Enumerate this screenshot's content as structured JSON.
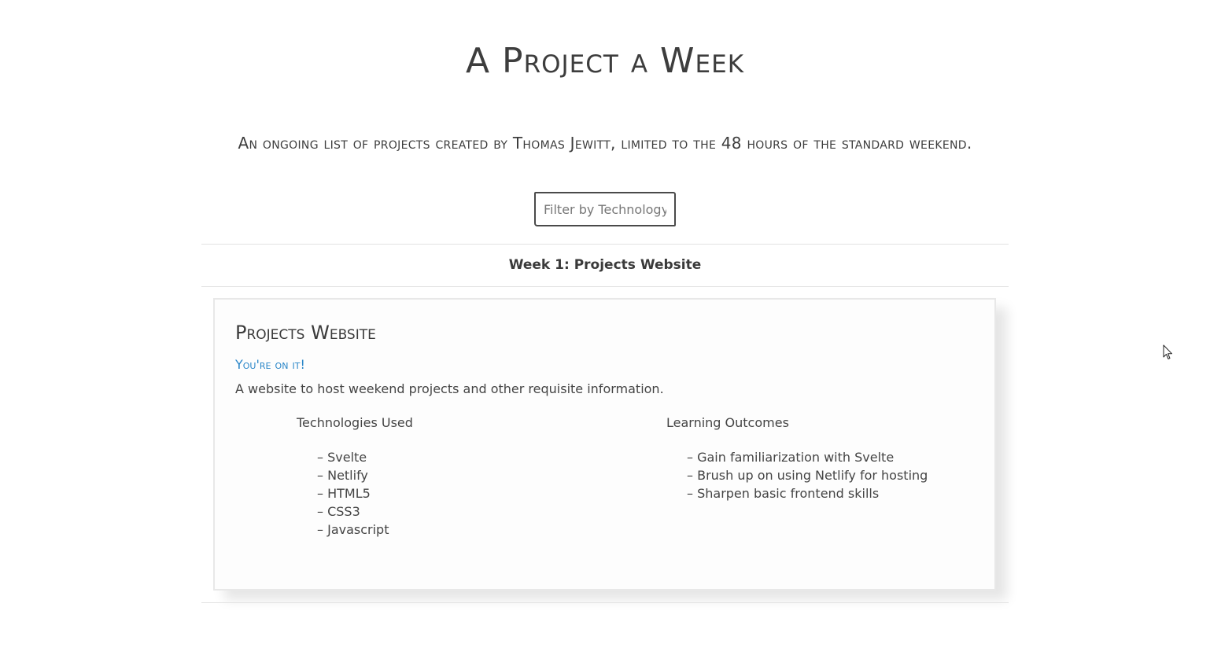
{
  "header": {
    "title": "A Project a Week",
    "subtitle": "An ongoing list of projects created by Thomas Jewitt, limited to the 48 hours of the standard weekend."
  },
  "filter": {
    "placeholder": "Filter by Technology",
    "value": ""
  },
  "weeks": [
    {
      "label": "Week 1: Projects Website",
      "project": {
        "title": "Projects Website",
        "link_text": "You're on it!",
        "description": "A website to host weekend projects and other requisite information.",
        "technologies_heading": "Technologies Used",
        "technologies": [
          "Svelte",
          "Netlify",
          "HTML5",
          "CSS3",
          "Javascript"
        ],
        "outcomes_heading": "Learning Outcomes",
        "outcomes": [
          "Gain familiarization with Svelte",
          "Brush up on using Netlify for hosting",
          "Sharpen basic frontend skills"
        ]
      }
    }
  ],
  "colors": {
    "text": "#3f3f3f",
    "link": "#2a86c8",
    "divider": "#e3e3e3",
    "card_border": "#e8e8e8"
  },
  "icons": {
    "cursor": "mouse-pointer-icon"
  }
}
